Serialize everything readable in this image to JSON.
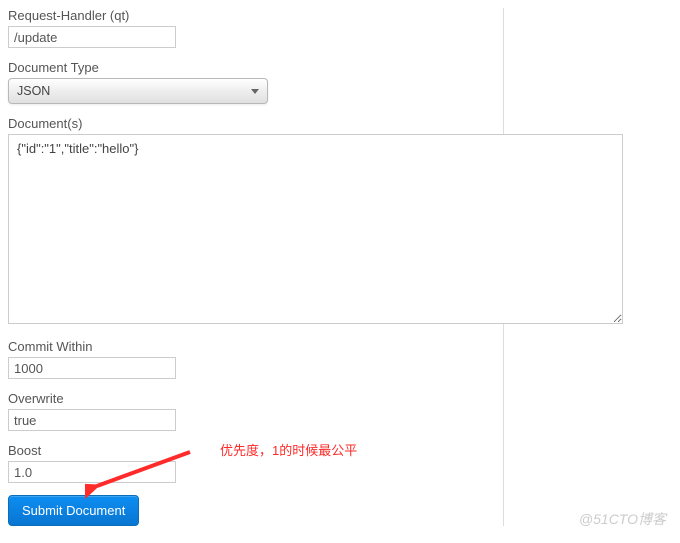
{
  "form": {
    "requestHandler": {
      "label": "Request-Handler (qt)",
      "value": "/update"
    },
    "documentType": {
      "label": "Document Type",
      "selected": "JSON"
    },
    "documents": {
      "label": "Document(s)",
      "value": "{\"id\":\"1\",\"title\":\"hello\"}"
    },
    "commitWithin": {
      "label": "Commit Within",
      "value": "1000"
    },
    "overwrite": {
      "label": "Overwrite",
      "value": "true"
    },
    "boost": {
      "label": "Boost",
      "value": "1.0"
    },
    "submit": {
      "label": "Submit Document"
    }
  },
  "annotation": {
    "text": "优先度，1的时候最公平"
  },
  "watermark": "@51CTO博客"
}
